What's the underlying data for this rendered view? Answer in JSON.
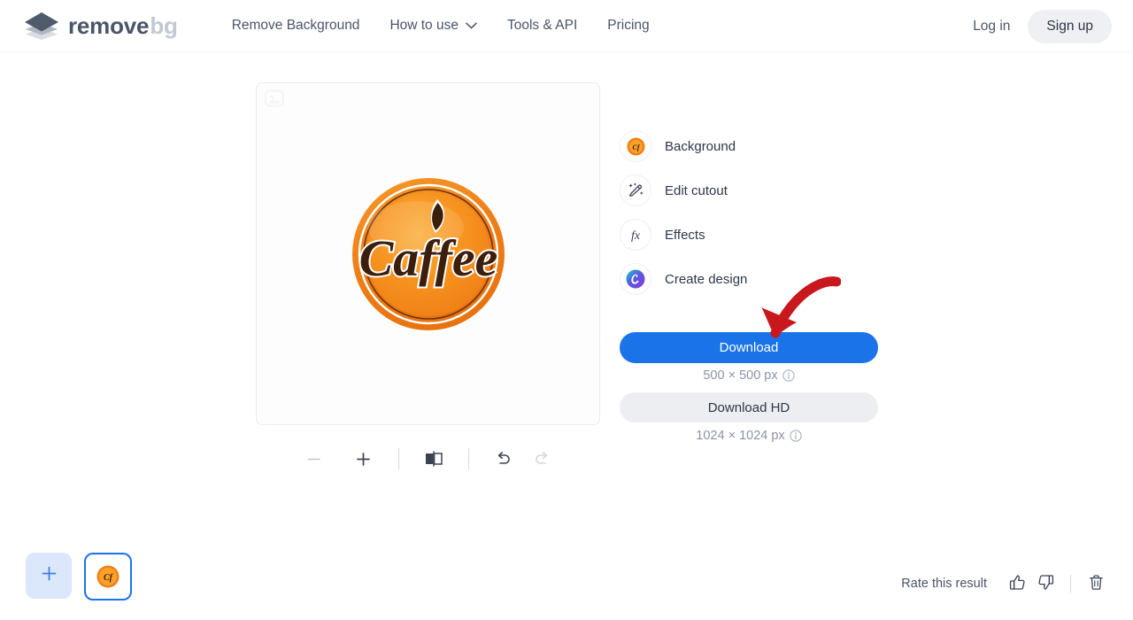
{
  "brand": {
    "name_primary": "remove",
    "name_secondary": "bg",
    "logo_icon": "stacked-layers-icon"
  },
  "header": {
    "nav": [
      {
        "label": "Remove Background",
        "has_chevron": false
      },
      {
        "label": "How to use",
        "has_chevron": true
      },
      {
        "label": "Tools & API",
        "has_chevron": false
      },
      {
        "label": "Pricing",
        "has_chevron": false
      }
    ],
    "login_label": "Log in",
    "signup_label": "Sign up"
  },
  "canvas": {
    "watermark_icon": "image-placeholder-icon",
    "artwork_text": "Caffee",
    "artwork_alt": "coffee-badge-logo"
  },
  "toolbar": {
    "items": [
      {
        "name": "zoom-out-button",
        "icon": "minus-icon",
        "disabled": true
      },
      {
        "name": "zoom-in-button",
        "icon": "plus-icon",
        "disabled": false
      },
      {
        "name": "compare-toggle-button",
        "icon": "split-compare-icon",
        "disabled": false
      },
      {
        "name": "undo-button",
        "icon": "undo-icon",
        "disabled": false
      },
      {
        "name": "redo-button",
        "icon": "redo-icon",
        "disabled": true
      }
    ]
  },
  "tools": [
    {
      "label": "Background",
      "icon": "background-thumbnail-icon"
    },
    {
      "label": "Edit cutout",
      "icon": "magic-brush-icon"
    },
    {
      "label": "Effects",
      "icon": "fx-icon"
    },
    {
      "label": "Create design",
      "icon": "canva-icon"
    }
  ],
  "download": {
    "primary_label": "Download",
    "primary_size": "500 × 500 px",
    "secondary_label": "Download HD",
    "secondary_size": "1024 × 1024 px",
    "info_icon": "info-circle-icon",
    "annotation": "red-curved-arrow"
  },
  "footer": {
    "add_image_icon": "plus-icon",
    "thumbnail_name": "image-thumbnail",
    "rate_label": "Rate this result",
    "thumbs_up_icon": "thumbs-up-icon",
    "thumbs_down_icon": "thumbs-down-icon",
    "delete_icon": "trash-icon"
  },
  "colors": {
    "accent_blue": "#1a73e8",
    "text_dark": "#2d3748",
    "text_muted": "#8a94a6",
    "annotation_red": "#c9181d",
    "logo_orange": "#f08020"
  }
}
